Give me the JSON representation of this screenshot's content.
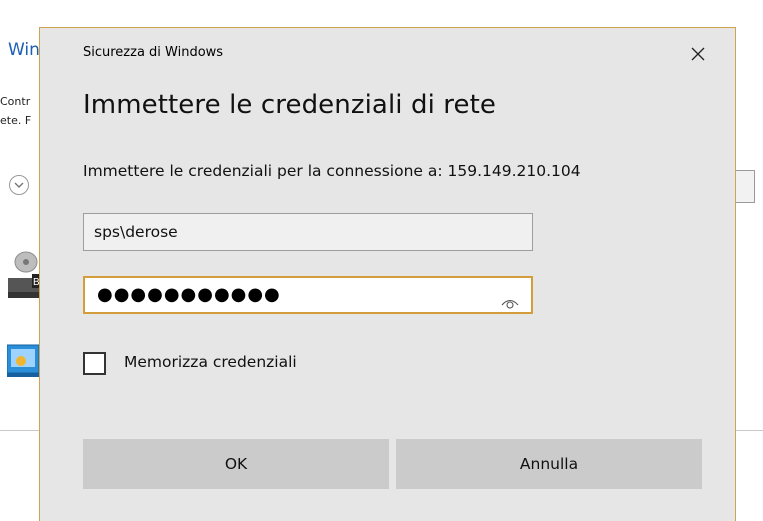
{
  "background": {
    "title": "Win",
    "line1": "Contr",
    "line2": "ete. F",
    "drive_label": "B"
  },
  "dialog": {
    "app_name": "Sicurezza di Windows",
    "title": "Immettere le credenziali di rete",
    "description": "Immettere le credenziali per la connessione a: 159.149.210.104",
    "username": "sps\\derose",
    "password_mask": "●●●●●●●●●●●",
    "remember_label": "Memorizza credenziali",
    "remember_checked": false,
    "ok_label": "OK",
    "cancel_label": "Annulla"
  },
  "colors": {
    "dialog_bg": "#e6e6e6",
    "focus_border": "#d39d3b",
    "button_bg": "#cbcbcb",
    "link_blue": "#1a5fb4"
  },
  "icons": [
    "close-icon",
    "eye-icon",
    "back-arrow-icon",
    "drive-icon",
    "network-icon"
  ]
}
